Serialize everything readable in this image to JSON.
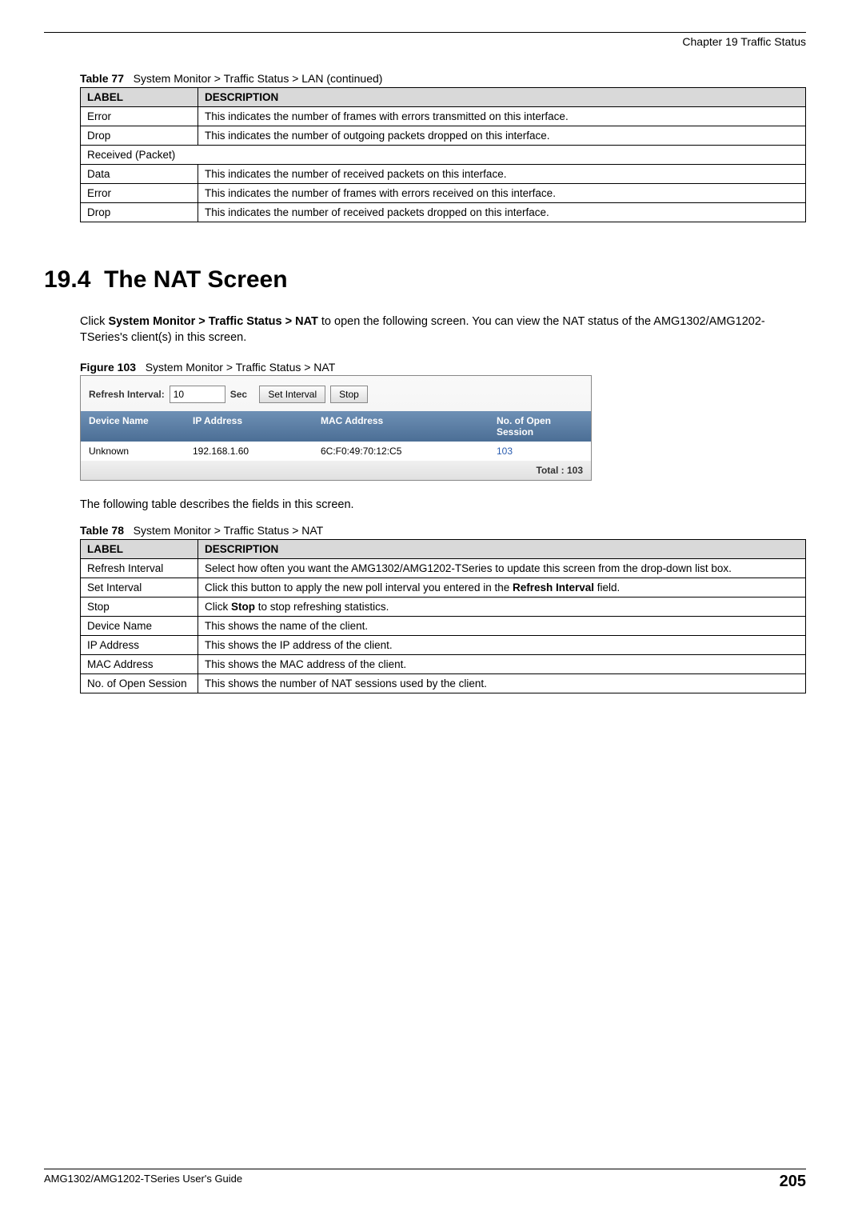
{
  "chapter_header": "Chapter 19 Traffic Status",
  "table77": {
    "caption_prefix": "Table 77",
    "caption_text": "System Monitor > Traffic Status > LAN (continued)",
    "header_label": "LABEL",
    "header_desc": "DESCRIPTION",
    "rows": [
      {
        "label": "Error",
        "indent": true,
        "desc": "This indicates the number of frames with errors transmitted on this interface."
      },
      {
        "label": "Drop",
        "indent": true,
        "desc": "This indicates the number of outgoing packets dropped on this interface."
      },
      {
        "label": "Received (Packet)",
        "span": true
      },
      {
        "label": "Data",
        "indent": true,
        "desc": "This indicates the number of received packets on this interface."
      },
      {
        "label": "Error",
        "indent": true,
        "desc": "This indicates the number of frames with errors received on this interface."
      },
      {
        "label": "Drop",
        "indent": true,
        "desc": "This indicates the number of received packets dropped on this interface."
      }
    ]
  },
  "section": {
    "number": "19.4",
    "title": "The NAT Screen",
    "intro_pre": "Click ",
    "intro_bold": "System Monitor > Traffic Status > NAT",
    "intro_post": " to open the following screen. You can view the NAT status of the AMG1302/AMG1202-TSeries's client(s) in this screen."
  },
  "figure": {
    "caption_prefix": "Figure 103",
    "caption_text": "System Monitor > Traffic Status > NAT",
    "refresh_label": "Refresh Interval:",
    "refresh_value": "10",
    "sec_label": "Sec",
    "set_btn": "Set Interval",
    "stop_btn": "Stop",
    "hdr_device": "Device Name",
    "hdr_ip": "IP Address",
    "hdr_mac": "MAC Address",
    "hdr_sess": "No. of Open Session",
    "row_device": "Unknown",
    "row_ip": "192.168.1.60",
    "row_mac": "6C:F0:49:70:12:C5",
    "row_sess": "103",
    "footer": "Total : 103"
  },
  "after_figure_text": "The following table describes the fields in this screen.",
  "table78": {
    "caption_prefix": "Table 78",
    "caption_text": "System Monitor > Traffic Status > NAT",
    "header_label": "LABEL",
    "header_desc": "DESCRIPTION",
    "rows": [
      {
        "label": "Refresh Interval",
        "desc": "Select how often you want the AMG1302/AMG1202-TSeries to update this screen from the drop-down list box."
      },
      {
        "label": "Set Interval",
        "desc_pre": "Click this button to apply the new poll interval you entered in the ",
        "desc_bold": "Refresh Interval",
        "desc_post": " field."
      },
      {
        "label": "Stop",
        "desc_pre": "Click ",
        "desc_bold": "Stop",
        "desc_post": " to stop refreshing statistics."
      },
      {
        "label": "Device Name",
        "desc": "This shows the name of the client."
      },
      {
        "label": "IP Address",
        "desc": "This shows the IP address of the client."
      },
      {
        "label": "MAC Address",
        "desc": "This shows the MAC address of the client."
      },
      {
        "label": "No. of Open Session",
        "desc": "This shows the number of NAT sessions used by the client."
      }
    ]
  },
  "footer": {
    "guide_name": "AMG1302/AMG1202-TSeries User's Guide",
    "page": "205"
  }
}
